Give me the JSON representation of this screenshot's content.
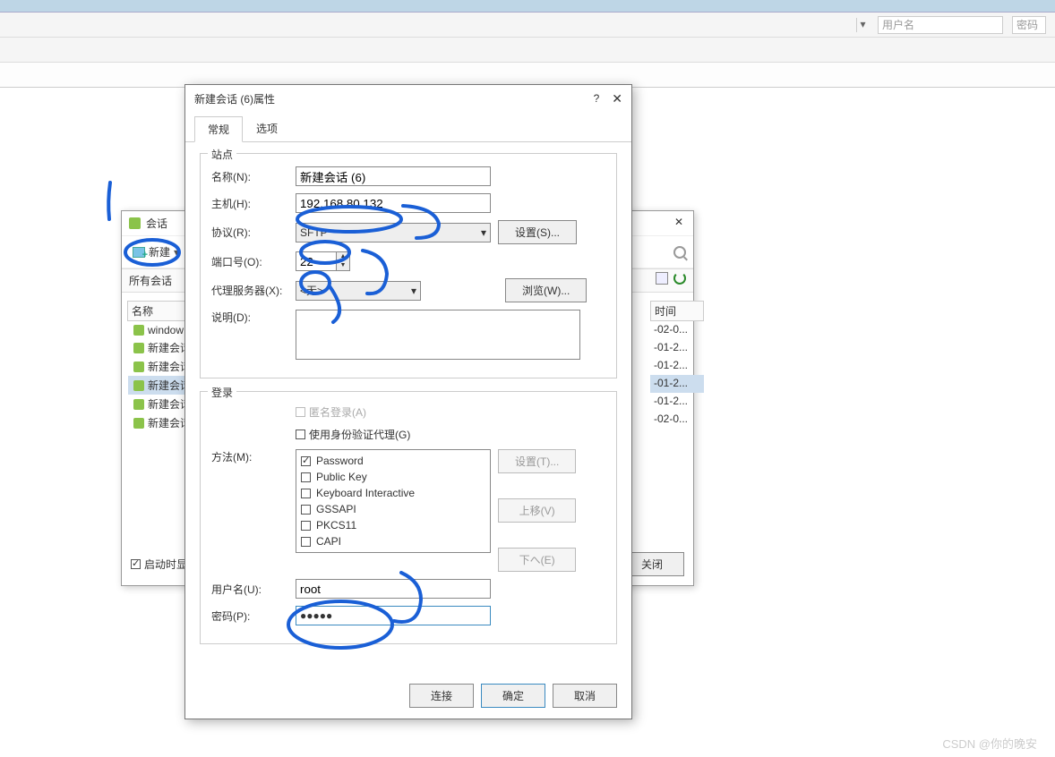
{
  "toolbar": {
    "username_ph": "用户名",
    "password_ph": "密码"
  },
  "sessions_panel": {
    "title": "会话",
    "new_button": "新建",
    "all_sessions": "所有会话",
    "header_name": "名称",
    "header_time": "时间",
    "items": [
      "window",
      "新建会话",
      "新建会话",
      "新建会话",
      "新建会话",
      "新建会话"
    ],
    "times": [
      "-02-0...",
      "-01-2...",
      "-01-2...",
      "-01-2...",
      "-01-2...",
      "-02-0..."
    ],
    "selected_index": 3,
    "startup_check": "启动时显",
    "close": "关闭"
  },
  "dialog": {
    "title": "新建会话 (6)属性",
    "tabs": {
      "general": "常规",
      "options": "选项"
    },
    "site_group": "站点",
    "login_group": "登录",
    "name_label": "名称(N):",
    "name_value": "新建会话 (6)",
    "host_label": "主机(H):",
    "host_value": "192.168.80.132",
    "protocol_label": "协议(R):",
    "protocol_value": "SFTP",
    "settings_btn": "设置(S)...",
    "port_label": "端口号(O):",
    "port_value": "22",
    "proxy_label": "代理服务器(X):",
    "proxy_value": "<无>",
    "browse_btn": "浏览(W)...",
    "desc_label": "说明(D):",
    "anon_label": "匿名登录(A)",
    "agent_label": "使用身份验证代理(G)",
    "method_label": "方法(M):",
    "methods": [
      "Password",
      "Public Key",
      "Keyboard Interactive",
      "GSSAPI",
      "PKCS11",
      "CAPI"
    ],
    "method_checked": [
      true,
      false,
      false,
      false,
      false,
      false
    ],
    "settings2_btn": "设置(T)...",
    "moveup_btn": "上移(V)",
    "movedn_btn": "下へ(E)",
    "user_label": "用户名(U):",
    "user_value": "root",
    "pass_label": "密码(P):",
    "pass_value": "●●●●●",
    "connect_btn": "连接",
    "ok_btn": "确定",
    "cancel_btn": "取消"
  },
  "watermark": "CSDN @你的晚安"
}
